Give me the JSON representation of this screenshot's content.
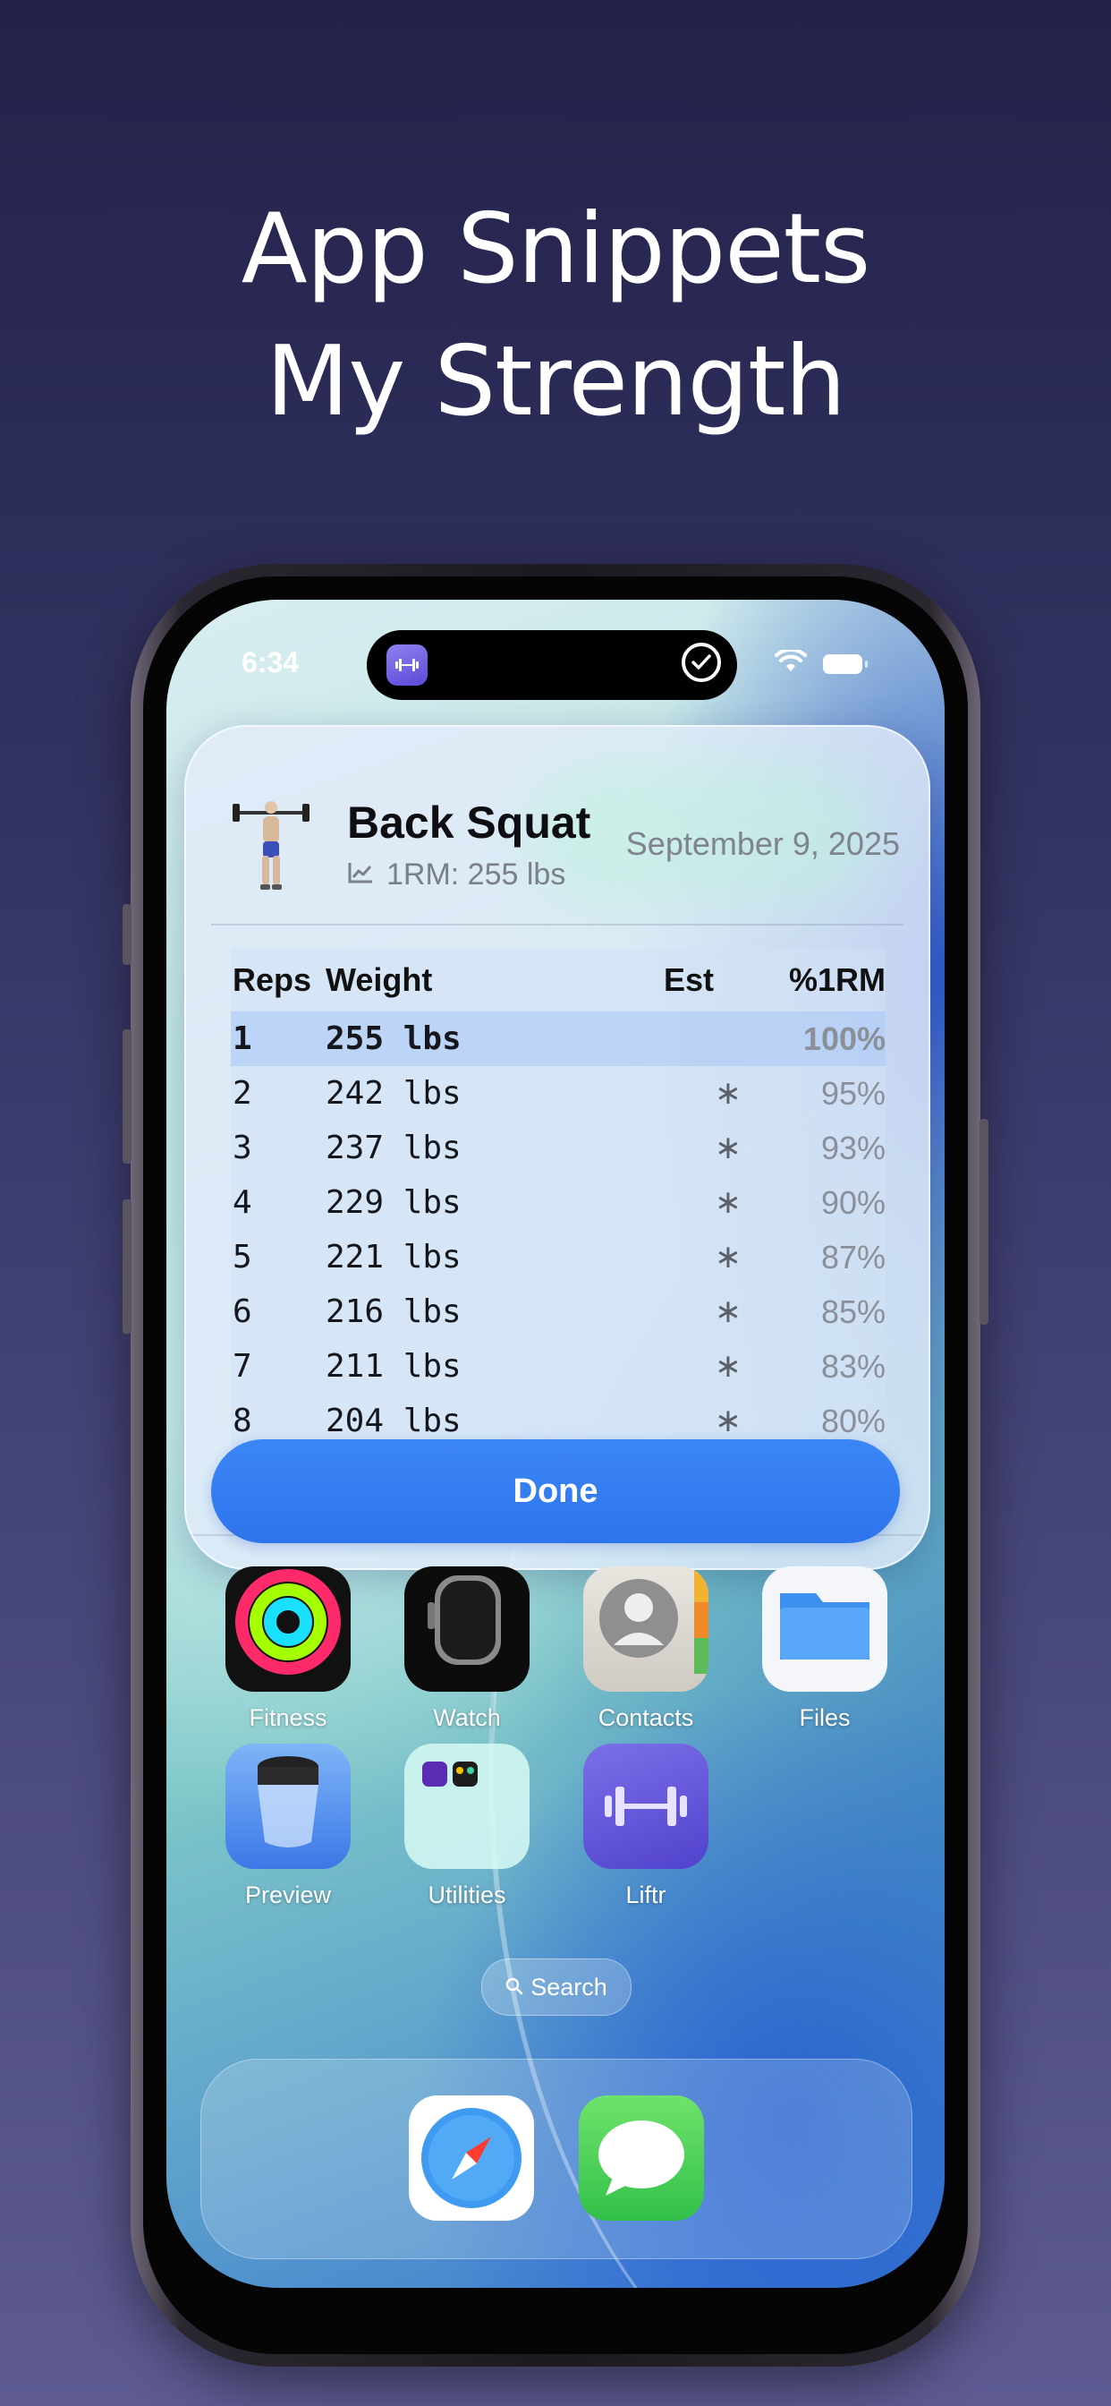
{
  "headline": {
    "line1": "App Snippets",
    "line2": "My Strength"
  },
  "status_bar": {
    "time": "6:34",
    "icons": [
      "wifi-icon",
      "battery-icon"
    ]
  },
  "dynamic_island": {
    "app_icon": "dumbbell-icon",
    "status_icon": "checkmark-circle-icon"
  },
  "snippet": {
    "exercise": "Back Squat",
    "one_rm": "1RM: 255 lbs",
    "date": "September 9, 2025",
    "columns": {
      "reps": "Reps",
      "weight": "Weight",
      "est": "Est",
      "pct": "%1RM"
    },
    "rows": [
      {
        "reps": "1",
        "weight": "255 lbs",
        "est": "",
        "pct": "100%"
      },
      {
        "reps": "2",
        "weight": "242 lbs",
        "est": "∗",
        "pct": "95%"
      },
      {
        "reps": "3",
        "weight": "237 lbs",
        "est": "∗",
        "pct": "93%"
      },
      {
        "reps": "4",
        "weight": "229 lbs",
        "est": "∗",
        "pct": "90%"
      },
      {
        "reps": "5",
        "weight": "221 lbs",
        "est": "∗",
        "pct": "87%"
      },
      {
        "reps": "6",
        "weight": "216 lbs",
        "est": "∗",
        "pct": "85%"
      },
      {
        "reps": "7",
        "weight": "211 lbs",
        "est": "∗",
        "pct": "83%"
      },
      {
        "reps": "8",
        "weight": "204 lbs",
        "est": "∗",
        "pct": "80%"
      }
    ],
    "done_label": "Done"
  },
  "home_apps": [
    {
      "label": "Fitness",
      "icon": "fitness-rings-icon"
    },
    {
      "label": "Watch",
      "icon": "watch-icon"
    },
    {
      "label": "Contacts",
      "icon": "contacts-icon"
    },
    {
      "label": "Files",
      "icon": "folder-icon"
    },
    {
      "label": "Preview",
      "icon": "preview-icon"
    },
    {
      "label": "Utilities",
      "icon": "folder-utilities-icon"
    },
    {
      "label": "Liftr",
      "icon": "dumbbell-icon"
    }
  ],
  "search": {
    "label": "Search",
    "icon": "search-icon"
  },
  "dock": [
    {
      "icon": "safari-compass-icon"
    },
    {
      "icon": "messages-bubble-icon"
    }
  ],
  "colors": {
    "accent": "#3582F3",
    "background_top": "#22224A",
    "background_bottom": "#5D5B92"
  }
}
